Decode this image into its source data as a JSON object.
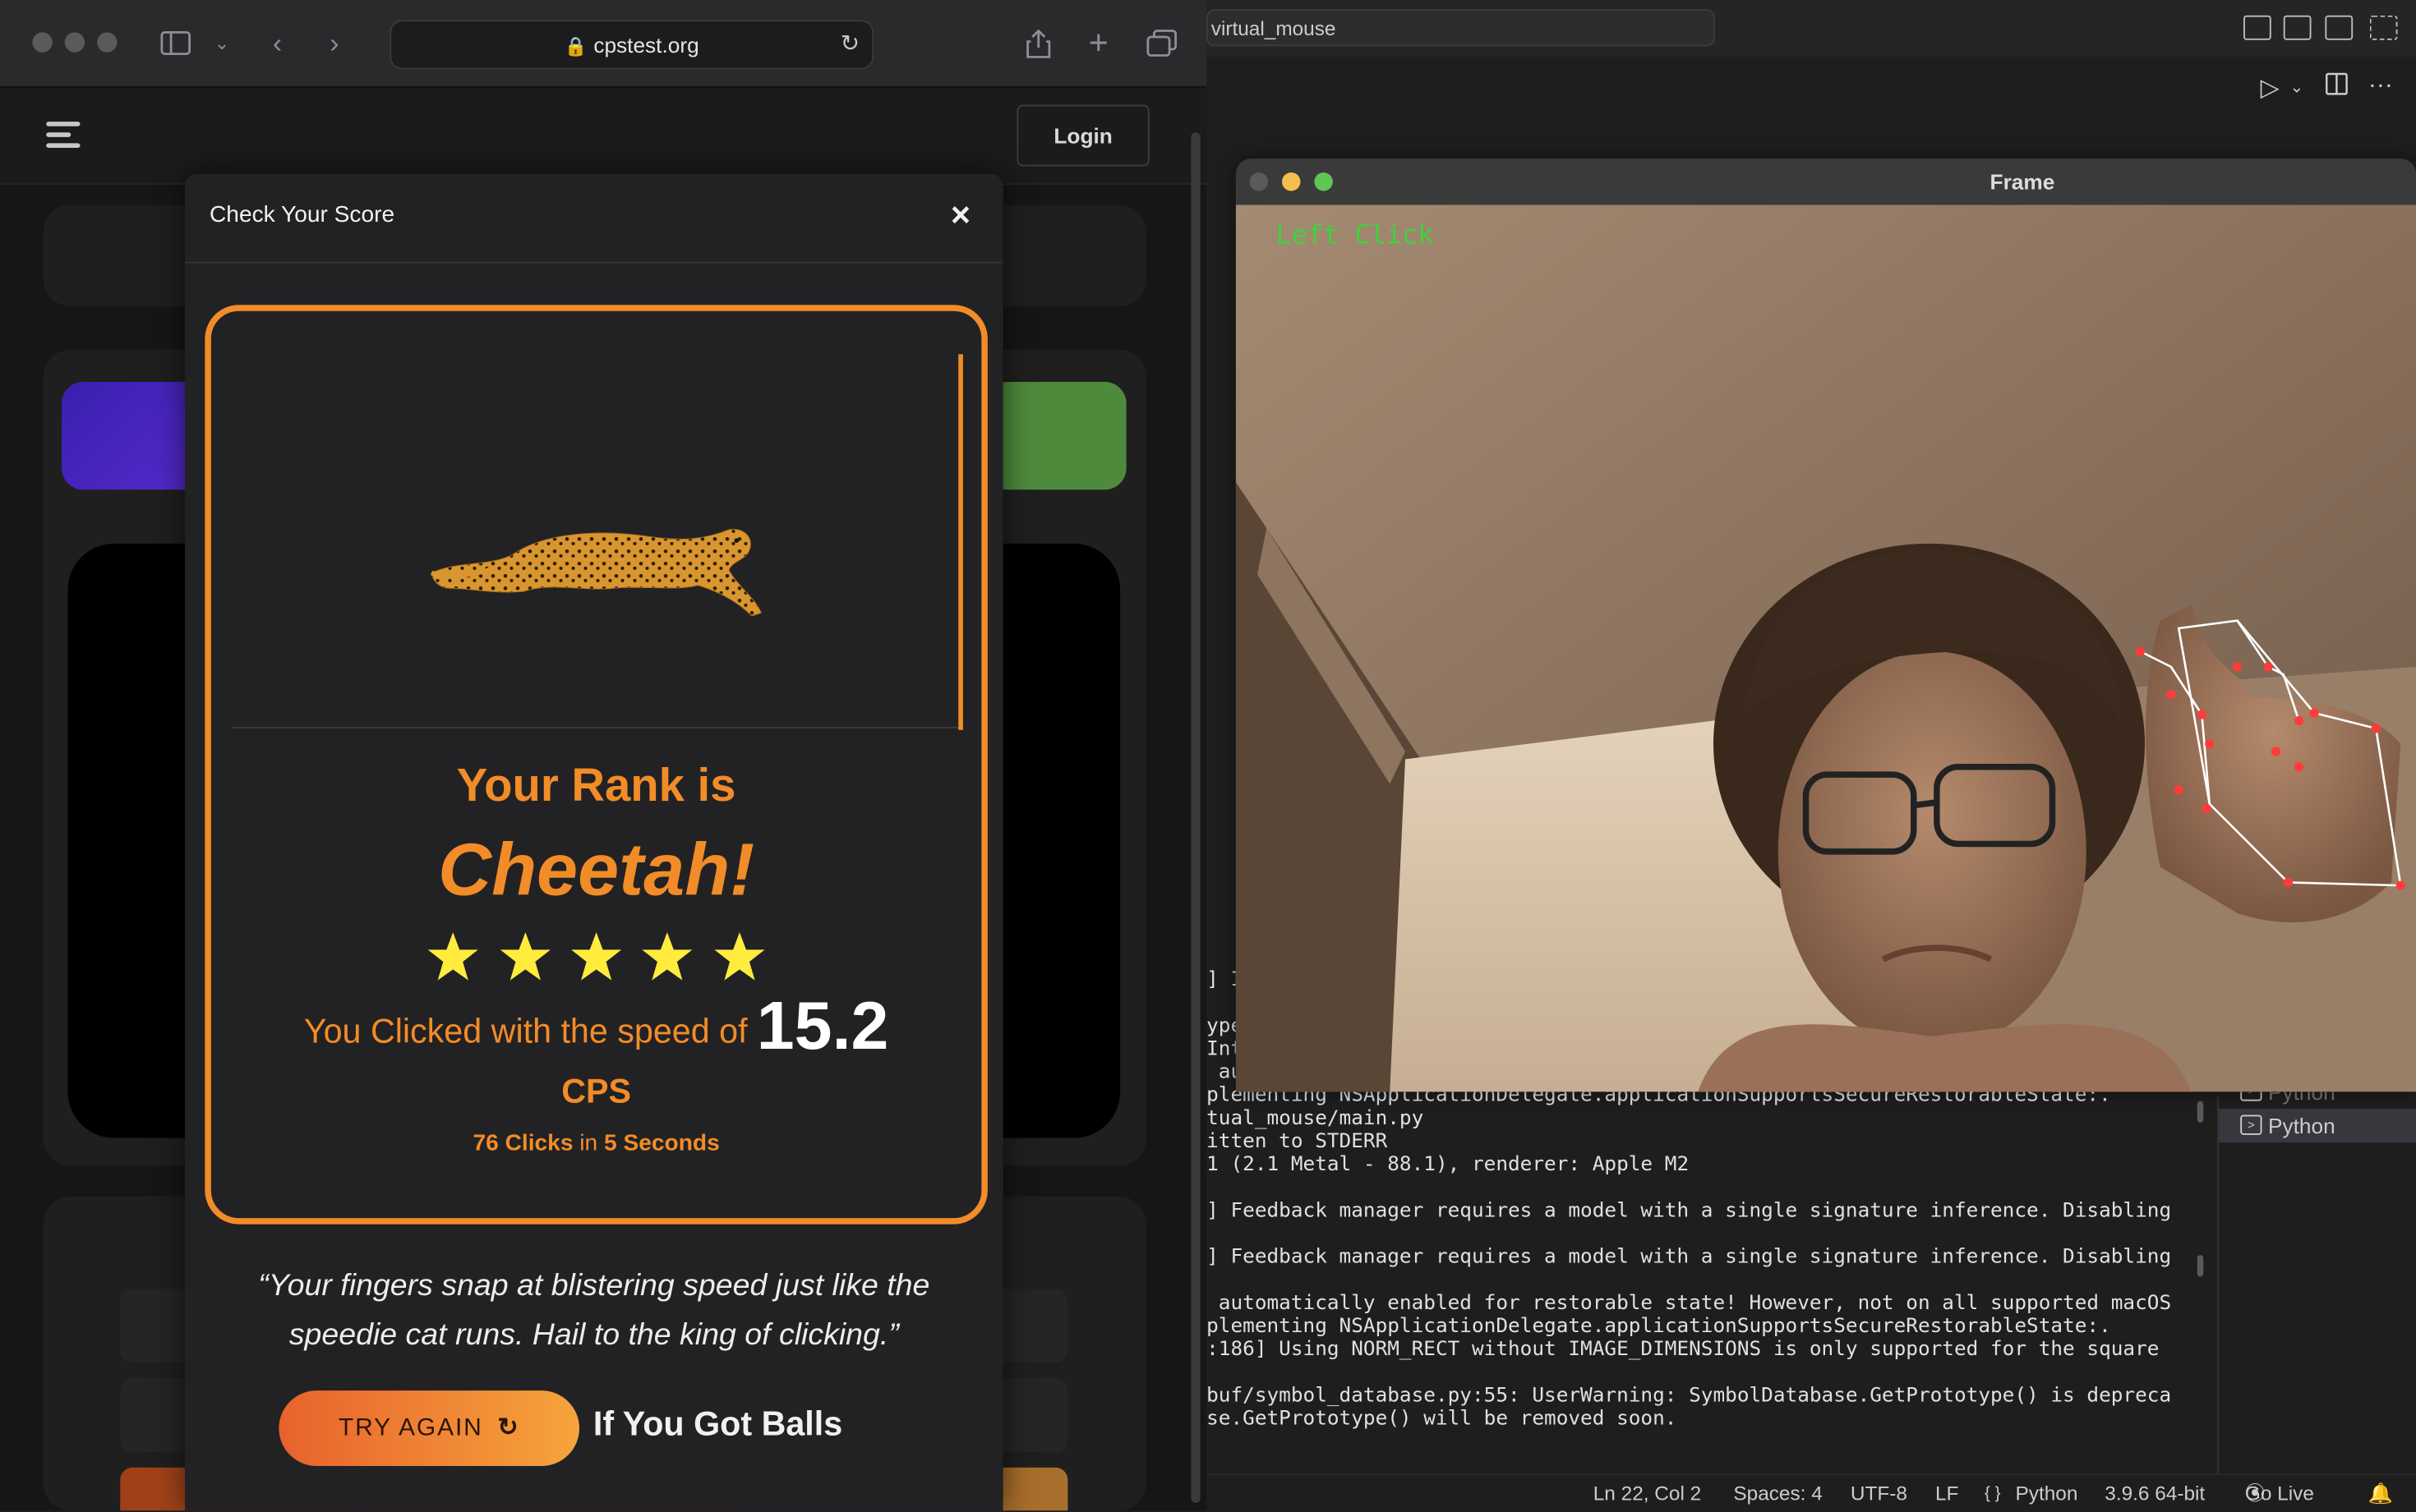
{
  "browser": {
    "url": "cpstest.org",
    "login_label": "Login"
  },
  "modal": {
    "title": "Check Your Score",
    "close_symbol": "×",
    "rank_prefix": "Your Rank is",
    "rank_name": "Cheetah!",
    "stars": 5,
    "speed_prefix": "You Clicked with the speed of",
    "speed_value": "15.2",
    "speed_unit": "CPS",
    "clicks_count": "76 Clicks",
    "clicks_in": "in",
    "seconds": "5 Seconds",
    "quote": "“Your fingers snap at blistering speed just like the speedie cat runs. Hail to the king of clicking.”",
    "try_again_label": "TRY AGAIN",
    "balls_text": "If You Got Balls",
    "accent_color": "#f28c28"
  },
  "vscode": {
    "search_text": "virtual_mouse",
    "terminal_lines": [
      "] I",
      "ype",
      "Int",
      " au",
      "plementing NSApplicationDelegate.applicationSupportsSecureRestorableState:.",
      "tual_mouse/main.py",
      "itten to STDERR",
      "1 (2.1 Metal - 88.1), renderer: Apple M2",
      "",
      "] Feedback manager requires a model with a single signature inference. Disabling",
      "",
      "] Feedback manager requires a model with a single signature inference. Disabling",
      "",
      " automatically enabled for restorable state! However, not on all supported macOS",
      "plementing NSApplicationDelegate.applicationSupportsSecureRestorableState:.",
      ":186] Using NORM_RECT without IMAGE_DIMENSIONS is only supported for the square",
      "",
      "buf/symbol_database.py:55: UserWarning: SymbolDatabase.GetPrototype() is depreca",
      "se.GetPrototype() will be removed soon."
    ],
    "terminals": [
      "Python",
      "Python"
    ],
    "status": {
      "position": "Ln 22, Col 2",
      "spaces": "Spaces: 4",
      "encoding": "UTF-8",
      "eol": "LF",
      "language": "Python",
      "braces": "{ }",
      "interpreter": "3.9.6 64-bit",
      "golive": "Go Live"
    }
  },
  "frame": {
    "title": "Frame",
    "label": "Left  Click"
  }
}
